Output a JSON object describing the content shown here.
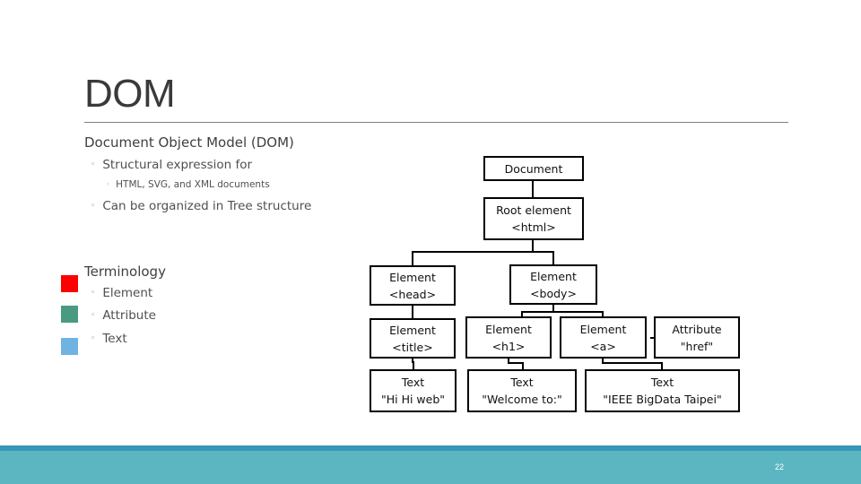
{
  "slide": {
    "title": "DOM",
    "page_number": "22"
  },
  "content": {
    "heading": "Document Object Model (DOM)",
    "items": [
      {
        "text": "Structural expression for",
        "level": 2
      },
      {
        "text": "HTML, SVG, and XML documents",
        "level": 3
      },
      {
        "text": "Can be organized in Tree structure",
        "level": 2
      }
    ],
    "bullet_glyph": "◦",
    "sub_bullet_glyph": "▫"
  },
  "terminology": {
    "heading": "Terminology",
    "items": [
      {
        "label": "Element",
        "color": "#ff0000"
      },
      {
        "label": "Attribute",
        "color": "#4a9a82"
      },
      {
        "label": "Text",
        "color": "#6fb3e3"
      }
    ]
  },
  "tree": {
    "nodes": {
      "document": {
        "line1": "Document",
        "line2": ""
      },
      "html": {
        "line1": "Root element",
        "line2": "<html>"
      },
      "head": {
        "line1": "Element",
        "line2": "<head>"
      },
      "body": {
        "line1": "Element",
        "line2": "<body>"
      },
      "title": {
        "line1": "Element",
        "line2": "<title>"
      },
      "h1": {
        "line1": "Element",
        "line2": "<h1>"
      },
      "a": {
        "line1": "Element",
        "line2": "<a>"
      },
      "href": {
        "line1": "Attribute",
        "line2": "\"href\""
      },
      "text_title": {
        "line1": "Text",
        "line2": "\"Hi Hi web\""
      },
      "text_h1": {
        "line1": "Text",
        "line2": "\"Welcome to:\""
      },
      "text_a": {
        "line1": "Text",
        "line2": "\"IEEE BigData Taipei\""
      }
    },
    "edges": [
      [
        "document",
        "html"
      ],
      [
        "html",
        "head"
      ],
      [
        "html",
        "body"
      ],
      [
        "head",
        "title"
      ],
      [
        "title",
        "text_title"
      ],
      [
        "body",
        "h1"
      ],
      [
        "body",
        "a"
      ],
      [
        "h1",
        "text_h1"
      ],
      [
        "a",
        "href"
      ],
      [
        "a",
        "text_a"
      ]
    ]
  },
  "theme": {
    "footer_color": "#5bb6c1",
    "footer_stripe_color": "#3896b8",
    "accent": "#4a9fb5"
  }
}
